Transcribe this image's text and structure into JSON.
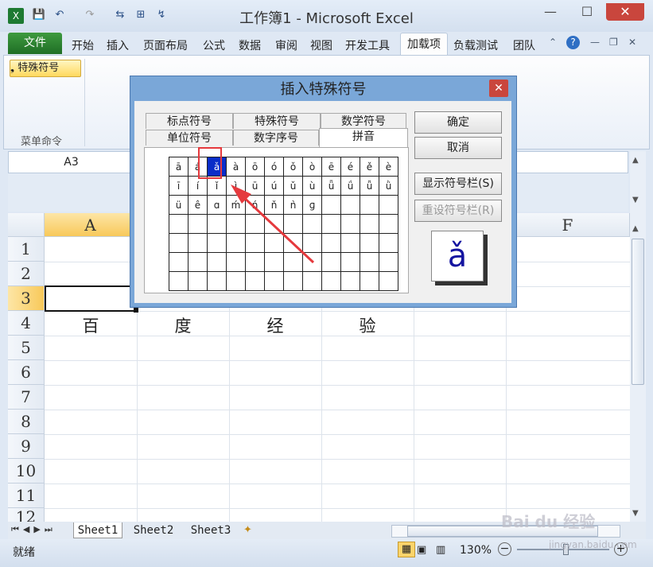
{
  "window": {
    "title": "工作簿1 - Microsoft Excel",
    "min": "—",
    "max": "☐",
    "close": "✕"
  },
  "quick_access": [
    "💾",
    "↶",
    "↷",
    "⇆",
    "⊞",
    "↯"
  ],
  "ribbon": {
    "file_tab": "文件",
    "tabs": [
      "开始",
      "插入",
      "页面布局",
      "公式",
      "数据",
      "审阅",
      "视图",
      "开发工具"
    ],
    "active_tab": "加载项",
    "tabs_right": [
      "负载测试",
      "团队"
    ],
    "addin_button": "❟ 特殊符号",
    "group_label": "菜单命令"
  },
  "name_box": "A3",
  "columns": [
    "A",
    "F"
  ],
  "rows": [
    "1",
    "2",
    "3",
    "4",
    "5",
    "6",
    "7",
    "8",
    "9",
    "10",
    "11",
    "12"
  ],
  "row4_cells": [
    "百",
    "度",
    "经",
    "验"
  ],
  "sheets": [
    "Sheet1",
    "Sheet2",
    "Sheet3"
  ],
  "status": {
    "ready": "就绪",
    "zoom": "130%"
  },
  "dialog": {
    "title": "插入特殊符号",
    "close": "✕",
    "tabs_back": [
      "标点符号",
      "特殊符号",
      "数学符号"
    ],
    "tabs_front": [
      "单位符号",
      "数字序号",
      "拼音"
    ],
    "rows": [
      [
        "ā",
        "á",
        "ǎ",
        "à",
        "ō",
        "ó",
        "ǒ",
        "ò",
        "ē",
        "é",
        "ě",
        "è"
      ],
      [
        "ī",
        "í",
        "ǐ",
        "ì",
        "ū",
        "ú",
        "ǔ",
        "ù",
        "ǖ",
        "ǘ",
        "ǚ",
        "ǜ"
      ],
      [
        "ü",
        "ê",
        "ɑ",
        "ḿ",
        "ń",
        "ň",
        "ǹ",
        "ɡ",
        "",
        "",
        "",
        ""
      ],
      [
        "",
        "",
        "",
        "",
        "",
        "",
        "",
        "",
        "",
        "",
        "",
        ""
      ],
      [
        "",
        "",
        "",
        "",
        "",
        "",
        "",
        "",
        "",
        "",
        "",
        ""
      ],
      [
        "",
        "",
        "",
        "",
        "",
        "",
        "",
        "",
        "",
        "",
        "",
        ""
      ],
      [
        "",
        "",
        "",
        "",
        "",
        "",
        "",
        "",
        "",
        "",
        "",
        ""
      ]
    ],
    "selected_row": 0,
    "selected_col": 2,
    "ok": "确定",
    "cancel": "取消",
    "show_bar": "显示符号栏(S)",
    "reset_bar": "重设符号栏(R)",
    "preview": "ǎ"
  },
  "watermark": "Bai du 经验",
  "watermark_url": "jingyan.baidu.com"
}
